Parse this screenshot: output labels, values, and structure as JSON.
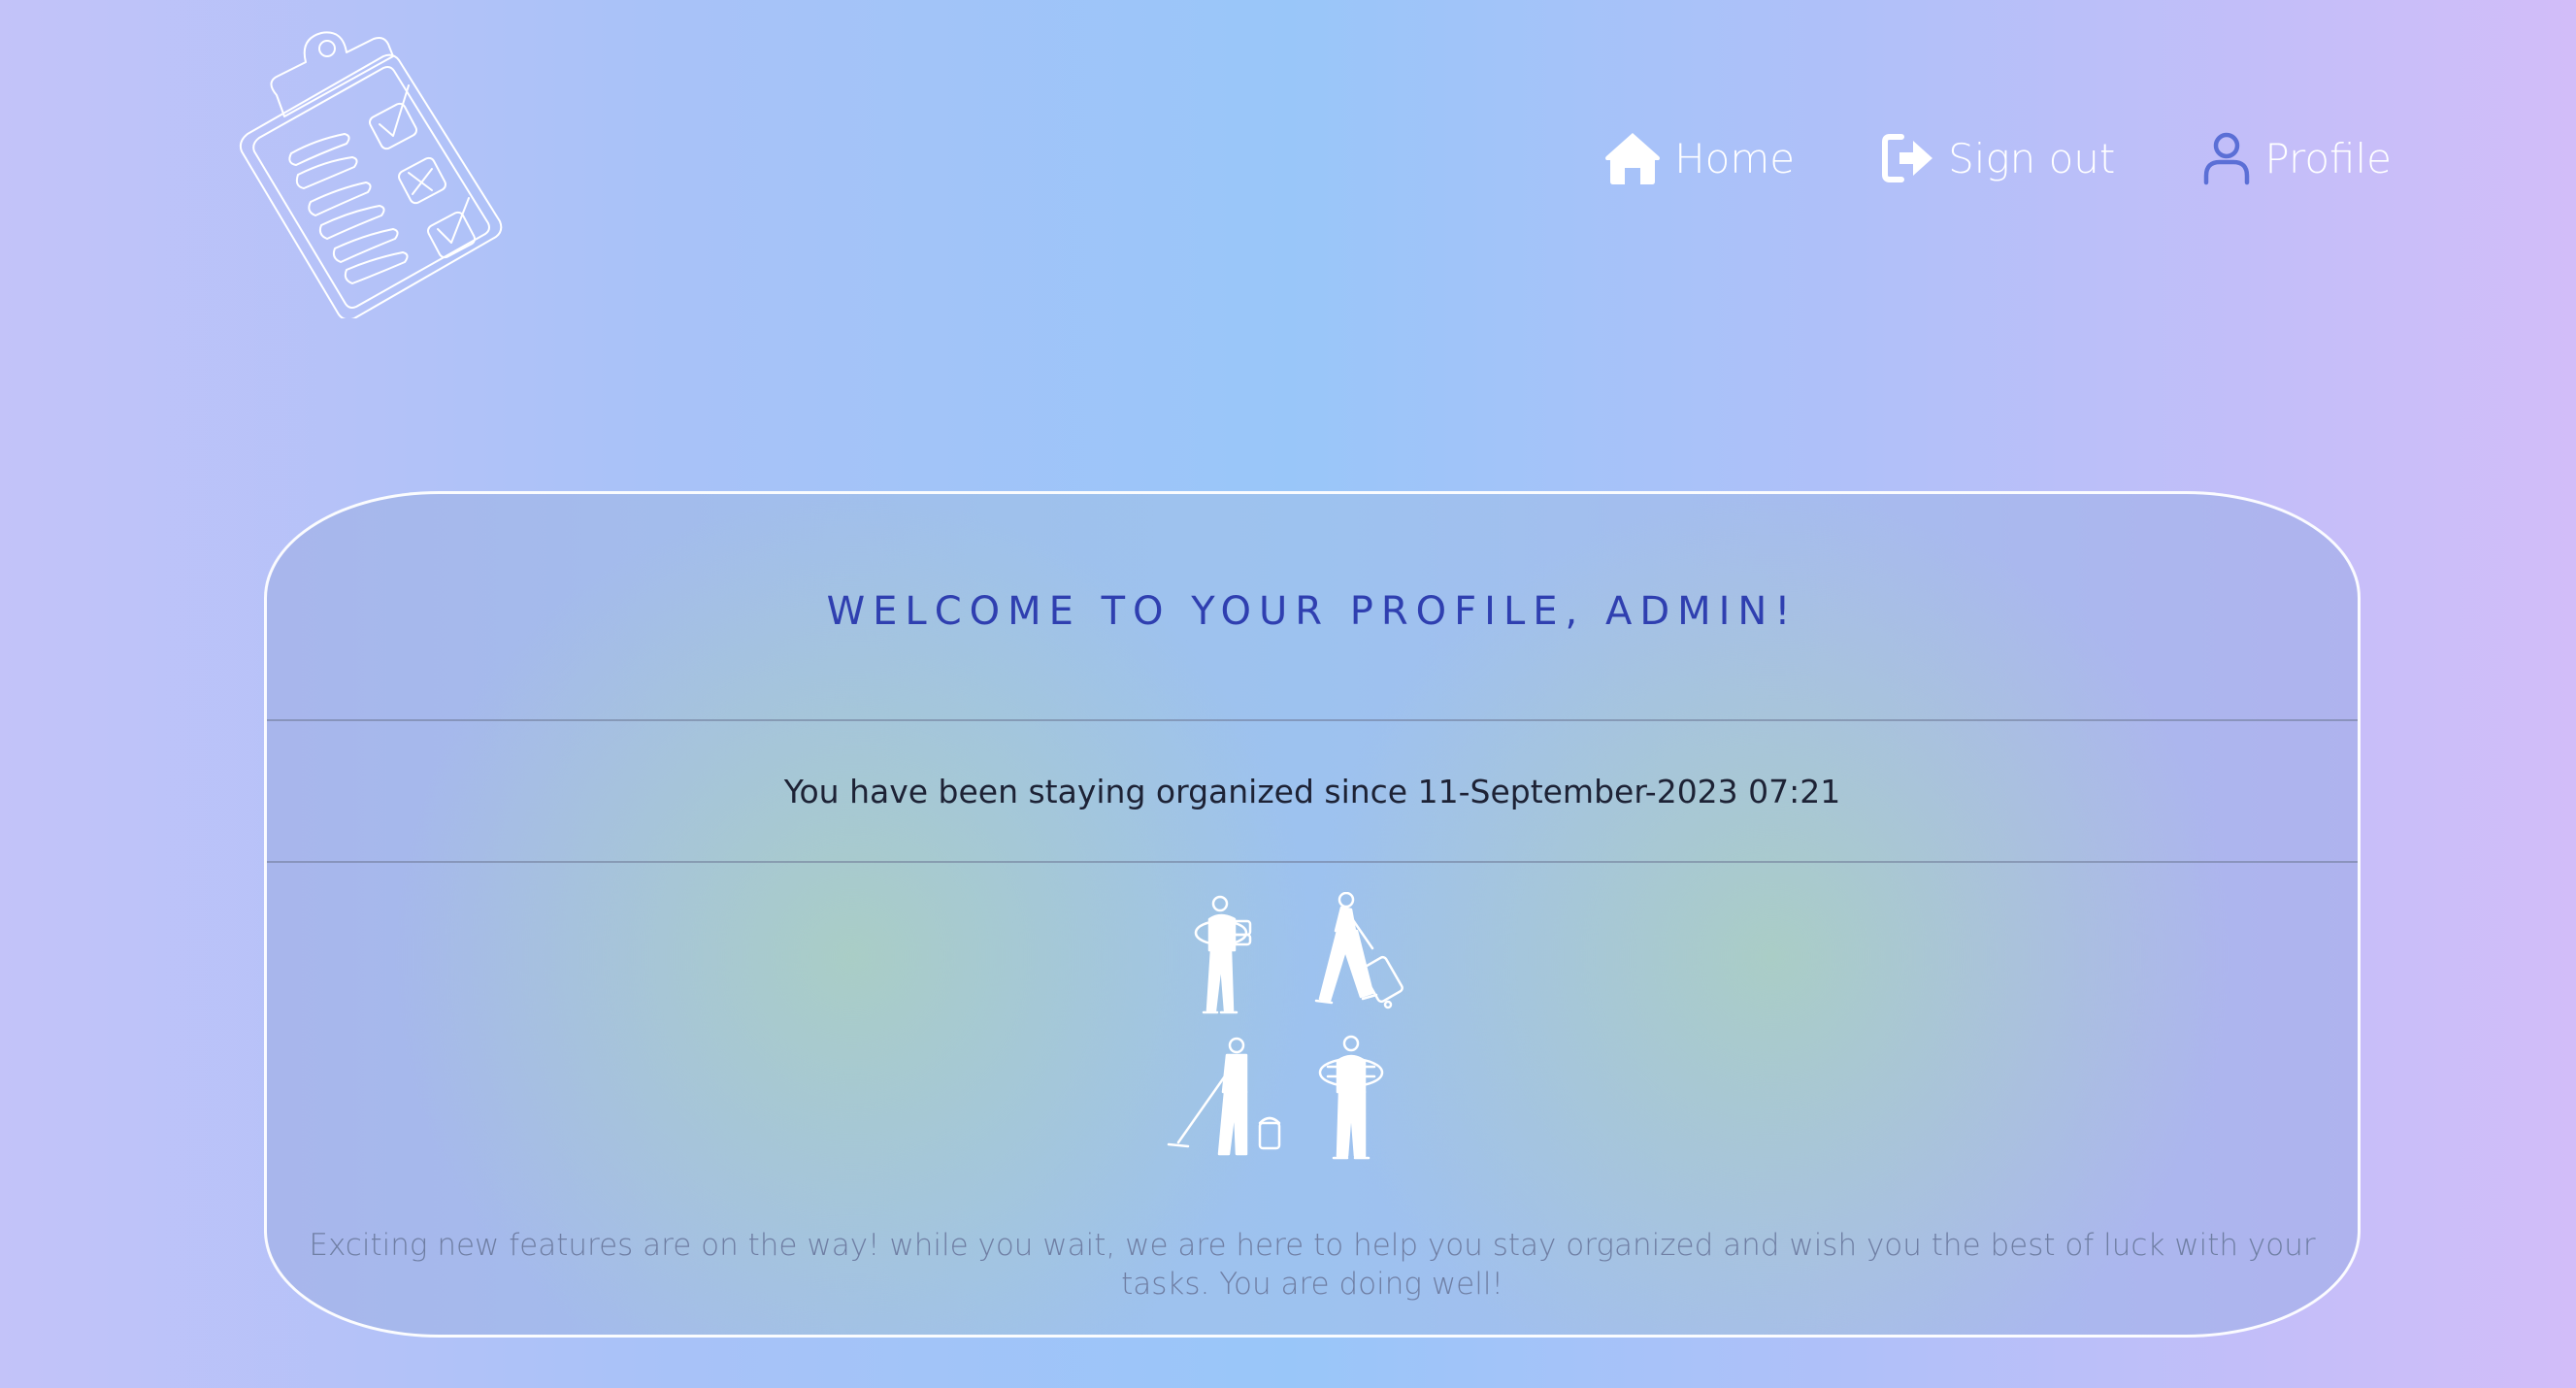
{
  "nav": {
    "items": [
      {
        "label": "Home",
        "icon": "home-icon"
      },
      {
        "label": "Sign out",
        "icon": "sign-out-icon"
      },
      {
        "label": "Profile",
        "icon": "user-icon"
      }
    ]
  },
  "logo": {
    "icon": "clipboard-checklist-icon"
  },
  "profile": {
    "title": "WELCOME TO YOUR PROFILE, ADMIN!",
    "since": "You have been staying organized since 11-September-2023 07:21",
    "illustration": "people-doing-chores-illustration",
    "message": "Exciting new features are on the way! while you wait, we are here to help you stay organized and wish you the best of luck with your tasks. You are doing well!"
  },
  "colors": {
    "title": "#2f3fb0",
    "nav_text": "#ffffff",
    "profile_icon": "#5b6fd6",
    "card_border": "#ffffff"
  }
}
